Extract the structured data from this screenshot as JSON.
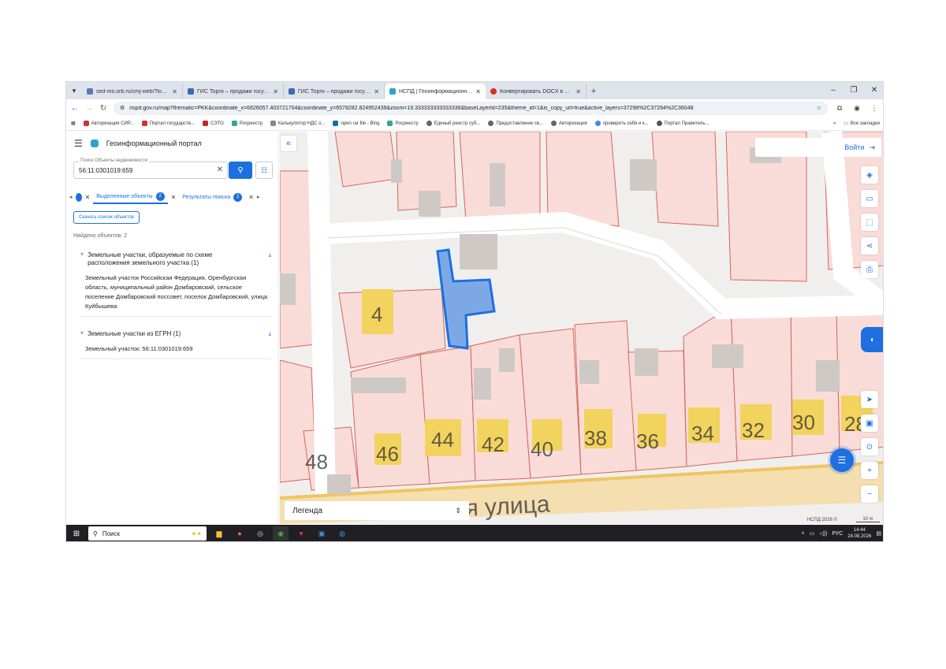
{
  "browser": {
    "tabs": [
      {
        "title": "sed-mo.orb.ru/cmj-web/?locale",
        "icon": "page-icon",
        "color": "#5a7bb5",
        "active": false
      },
      {
        "title": "ГИС Торги – продажи государ",
        "icon": "gis-icon",
        "color": "#3b6cb5",
        "active": false
      },
      {
        "title": "ГИС Торги – продажи государ",
        "icon": "gis-icon",
        "color": "#3b6cb5",
        "active": false
      },
      {
        "title": "НСПД | Геоинформационный",
        "icon": "nspd-icon",
        "color": "#2ba6c9",
        "active": true
      },
      {
        "title": "Конвертировать DOCX в JPG",
        "icon": "convert-icon",
        "color": "#d93025",
        "active": false
      }
    ],
    "url": "nspd.gov.ru/map?thematic=PKK&coordinate_x=6626057.403721704&coordinate_y=6578282.824952439&zoom=19.333333333333336&baseLayerId=235&theme_id=1&is_copy_url=true&active_layers=37298%2C37294%2C36048",
    "bookmarks": [
      "Авторизация СИР...",
      "Портал государств...",
      "СЭТО",
      "Росреестр",
      "Калькулятор НДС о...",
      "open rar file - Bing",
      "Росреестр",
      "Единый реестр суб...",
      "Предоставление св...",
      "Авторизация",
      "проверить себя и к...",
      "Портал Правитель..."
    ],
    "all_bookmarks": "Все закладки"
  },
  "panel": {
    "portal_title": "Геоинформационный портал",
    "search": {
      "label": "Поиск Объекты недвижимости",
      "value": "56:11:0301019:659"
    },
    "tabs": {
      "selected": {
        "label": "Выделенные объекты",
        "count": "2"
      },
      "results": {
        "label": "Результаты поиска",
        "count": "1"
      }
    },
    "download_label": "Скачать список объектов",
    "found_label": "Найдено объектов: 2",
    "groups": [
      {
        "title": "Земельные участки, образуемые по схеме расположения земельного участка (1)",
        "item": "Земельный участок Российская Федерация, Оренбургская область, муниципальный район Домбаровский, сельское поселение Домбаровский поссовет, поселок Домбаровский, улица Куйбышева"
      },
      {
        "title": "Земельные участки из ЕГРН (1)",
        "item": "Земельный участок: 56:11:0301019:659"
      }
    ]
  },
  "map": {
    "login_label": "Войти",
    "legend_label": "Легенда",
    "street_label": "я улица",
    "house_numbers": [
      "4",
      "44",
      "42",
      "40",
      "38",
      "36",
      "34",
      "32",
      "30",
      "28",
      "46",
      "48"
    ],
    "copyright": "НСПД 2026 ©",
    "scale": "10 m",
    "colors": {
      "parcel_fill": "#f9dcd8",
      "parcel_stroke": "#d9645d",
      "building": "#cfc9c6",
      "building_yellow": "#f2d35e",
      "selection": "#1e6fe0",
      "road": "#f5deb0"
    }
  },
  "taskbar": {
    "search_label": "Поиск",
    "lang": "РУС",
    "time": "14:44",
    "date": "24.08.2026"
  }
}
